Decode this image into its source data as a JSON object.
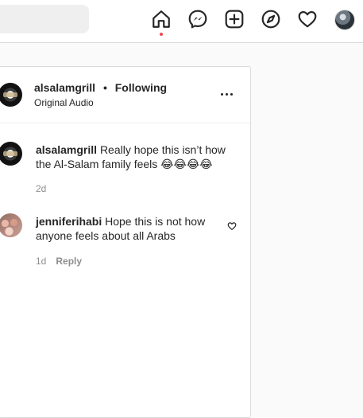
{
  "topbar": {
    "icons": [
      "home-icon",
      "messenger-icon",
      "new-post-icon",
      "explore-icon",
      "activity-heart-icon",
      "profile-avatar"
    ],
    "active": "home",
    "accent": "#ed4956"
  },
  "post": {
    "username": "alsalamgrill",
    "separator": "•",
    "follow_status": "Following",
    "audio": "Original Audio",
    "more_icon": "more-options-icon"
  },
  "comments": [
    {
      "username": "alsalamgrill",
      "text": "Really hope this isn’t how the Al-Salam family feels 😂😂😂😂",
      "time": "2d"
    },
    {
      "username": "jenniferihabi",
      "text": "Hope this is not how anyone feels about all Arabs",
      "time": "1d",
      "reply_label": "Reply"
    }
  ],
  "colors": {
    "border": "#dbdbdb",
    "text": "#262626",
    "secondary": "#8e8e8e"
  }
}
